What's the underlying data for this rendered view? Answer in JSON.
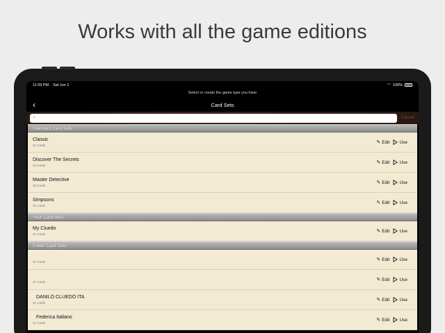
{
  "headline": "Works with all the game editions",
  "status": {
    "time": "11:09 PM",
    "date": "Sat Jun 1",
    "battery": "100%"
  },
  "prompt": "Select or create the game type you have",
  "navbar": {
    "title": "Card Sets"
  },
  "search": {
    "placeholder": "",
    "cancel_label": "Cancel"
  },
  "sections": [
    {
      "title": "Standard Card Sets",
      "rows": [
        {
          "name": "Classic",
          "count": "21 Cards"
        },
        {
          "name": "Discover The Secrets",
          "count": "24 Cards"
        },
        {
          "name": "Master Detective",
          "count": "30 Cards"
        },
        {
          "name": "Simpsons",
          "count": "21 Cards"
        }
      ]
    },
    {
      "title": "Your Card Sets",
      "rows": [
        {
          "name": "My Cluedo",
          "count": "21 Cards"
        }
      ]
    },
    {
      "title": "Public Card Sets",
      "rows": [
        {
          "name": "",
          "count": "27 Cards"
        },
        {
          "name": "",
          "count": "27 Cards"
        },
        {
          "name": "DANILO CLUEDO ITA",
          "count": "21 Cards"
        },
        {
          "name": "Federica Italiano",
          "count": "21 Cards"
        }
      ]
    }
  ],
  "actions": {
    "edit_label": "Edit",
    "use_label": "Use"
  },
  "icons": {
    "back": "chevron-left-icon",
    "search": "magnifier-icon",
    "edit": "pencil-icon",
    "use": "play-icon",
    "wifi": "wifi-icon",
    "battery": "battery-icon"
  }
}
